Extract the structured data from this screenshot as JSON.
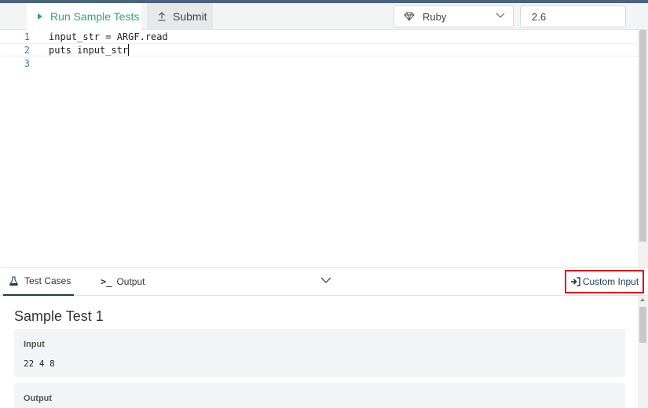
{
  "toolbar": {
    "run_label": "Run Sample Tests",
    "submit_label": "Submit",
    "language": "Ruby",
    "version": "2.6"
  },
  "editor": {
    "lines": [
      {
        "number": "1",
        "code": "input_str = ARGF.read"
      },
      {
        "number": "2",
        "code": "puts input_str"
      },
      {
        "number": "3",
        "code": ""
      }
    ]
  },
  "panel": {
    "tabs": {
      "test_cases": "Test Cases",
      "output": "Output"
    },
    "custom_input_label": "Custom Input"
  },
  "results": {
    "title": "Sample Test 1",
    "input_label": "Input",
    "input_value": "22 4 8",
    "output_label": "Output"
  },
  "colors": {
    "accent_green": "#31a66b",
    "highlight_red": "#e0101a",
    "navy": "#1f3c55"
  }
}
